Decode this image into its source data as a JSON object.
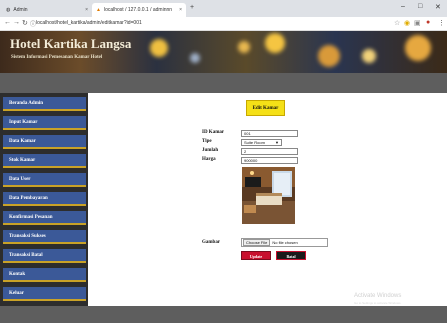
{
  "browser": {
    "tabs": [
      {
        "label": "Admin",
        "active": false
      },
      {
        "label": "localhost / 127.0.0.1 / adminnn",
        "active": true
      }
    ],
    "url": "localhost/hotel_kartika/admin/editkamar?id=001"
  },
  "header": {
    "title": "Hotel Kartika Langsa",
    "subtitle": "Sistem Informasi Pemesanan Kamar Hotel"
  },
  "sidebar": {
    "items": [
      {
        "label": "Beranda Admin"
      },
      {
        "label": "Input Kamar"
      },
      {
        "label": "Data Kamar"
      },
      {
        "label": "Stok Kamar"
      },
      {
        "label": "Data User"
      },
      {
        "label": "Data Pembayaran"
      },
      {
        "label": "Konfirmasi Pesanan"
      },
      {
        "label": "Transaksi Sukses"
      },
      {
        "label": "Transaksi Batal"
      },
      {
        "label": "Kontak"
      },
      {
        "label": "Keluar"
      }
    ]
  },
  "form": {
    "title": "Edit Kamar",
    "fields": {
      "id_label": "ID Kamar",
      "id_value": "001",
      "tipe_label": "Tipe",
      "tipe_value": "Suite Room",
      "jumlah_label": "Jumlah",
      "jumlah_value": "2",
      "harga_label": "Harga",
      "harga_value": "900000",
      "gambar_label": "Gambar"
    },
    "file": {
      "button": "Choose File",
      "status": "No file chosen"
    },
    "update_label": "Update",
    "cancel_label": "Batal"
  },
  "watermark": {
    "line1": "Activate Windows",
    "line2": "Go to Settings to activate Windows."
  },
  "colors": {
    "menu_bg": "#3b5998",
    "menu_border": "#c9a227",
    "title_yellow": "#f5e017",
    "update_red": "#c8102e"
  }
}
